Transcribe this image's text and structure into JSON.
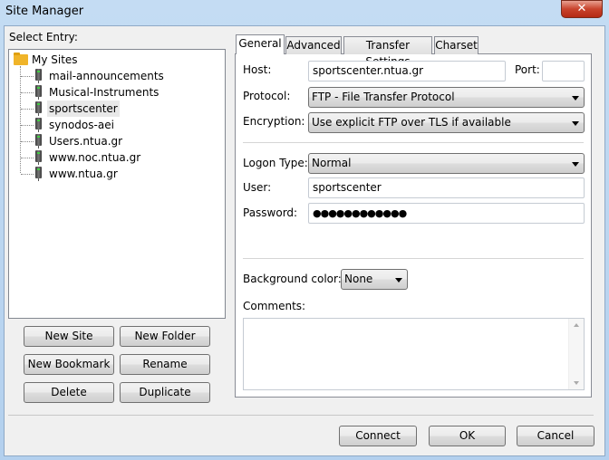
{
  "window": {
    "title": "Site Manager",
    "close_glyph": "✕"
  },
  "left": {
    "select_entry_label": "Select Entry:",
    "tree": {
      "root": "My Sites",
      "items": [
        "mail-announcements",
        "Musical-Instruments",
        "sportscenter",
        "synodos-aei",
        "Users.ntua.gr",
        "www.noc.ntua.gr",
        "www.ntua.gr"
      ],
      "selected": "sportscenter"
    },
    "buttons": {
      "new_site": "New Site",
      "new_folder": "New Folder",
      "new_bookmark": "New Bookmark",
      "rename": "Rename",
      "delete": "Delete",
      "duplicate": "Duplicate"
    }
  },
  "tabs": [
    {
      "label": "General",
      "active": true
    },
    {
      "label": "Advanced"
    },
    {
      "label": "Transfer Settings"
    },
    {
      "label": "Charset"
    }
  ],
  "general": {
    "host_label": "Host:",
    "host_value": "sportscenter.ntua.gr",
    "port_label": "Port:",
    "port_value": "",
    "protocol_label": "Protocol:",
    "protocol_value": "FTP - File Transfer Protocol",
    "encryption_label": "Encryption:",
    "encryption_value": "Use explicit FTP over TLS if available",
    "logon_label": "Logon Type:",
    "logon_value": "Normal",
    "user_label": "User:",
    "user_value": "sportscenter",
    "password_label": "Password:",
    "password_value": "●●●●●●●●●●●●",
    "bgcolor_label": "Background color:",
    "bgcolor_value": "None",
    "comments_label": "Comments:",
    "comments_value": ""
  },
  "footer": {
    "connect": "Connect",
    "ok": "OK",
    "cancel": "Cancel"
  }
}
